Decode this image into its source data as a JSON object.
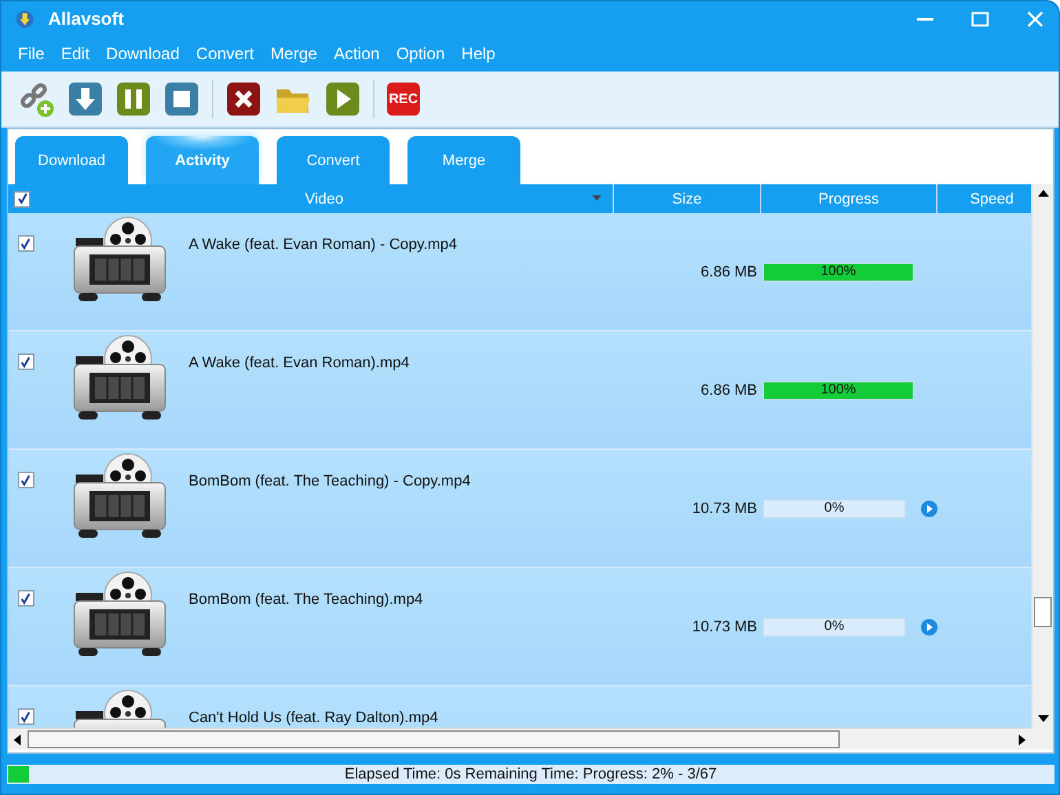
{
  "window": {
    "title": "Allavsoft"
  },
  "menu": [
    "File",
    "Edit",
    "Download",
    "Convert",
    "Merge",
    "Action",
    "Option",
    "Help"
  ],
  "toolbar": {
    "rec_label": "REC"
  },
  "tabs": [
    {
      "label": "Download",
      "selected": false
    },
    {
      "label": "Activity",
      "selected": true
    },
    {
      "label": "Convert",
      "selected": false
    },
    {
      "label": "Merge",
      "selected": false
    }
  ],
  "table": {
    "all_checked": true,
    "columns": [
      "Video",
      "Size",
      "Progress",
      "Speed"
    ],
    "rows": [
      {
        "checked": true,
        "name": "A Wake (feat. Evan Roman) - Copy.mp4",
        "size": "6.86 MB",
        "progress": "100%",
        "level": 1,
        "paused": false
      },
      {
        "checked": true,
        "name": "A Wake (feat. Evan Roman).mp4",
        "size": "6.86 MB",
        "progress": "100%",
        "level": 1,
        "paused": false
      },
      {
        "checked": true,
        "name": "BomBom (feat. The Teaching) - Copy.mp4",
        "size": "10.73 MB",
        "progress": "0%",
        "level": 0,
        "paused": true
      },
      {
        "checked": true,
        "name": "BomBom (feat. The Teaching).mp4",
        "size": "10.73 MB",
        "progress": "0%",
        "level": 0,
        "paused": true
      },
      {
        "checked": true,
        "name": "Can't Hold Us (feat. Ray Dalton).mp4"
      }
    ]
  },
  "status_bar": {
    "text": "Elapsed Time: 0s Remaining Time: Progress: 2% - 3/67",
    "level": 0.02
  }
}
